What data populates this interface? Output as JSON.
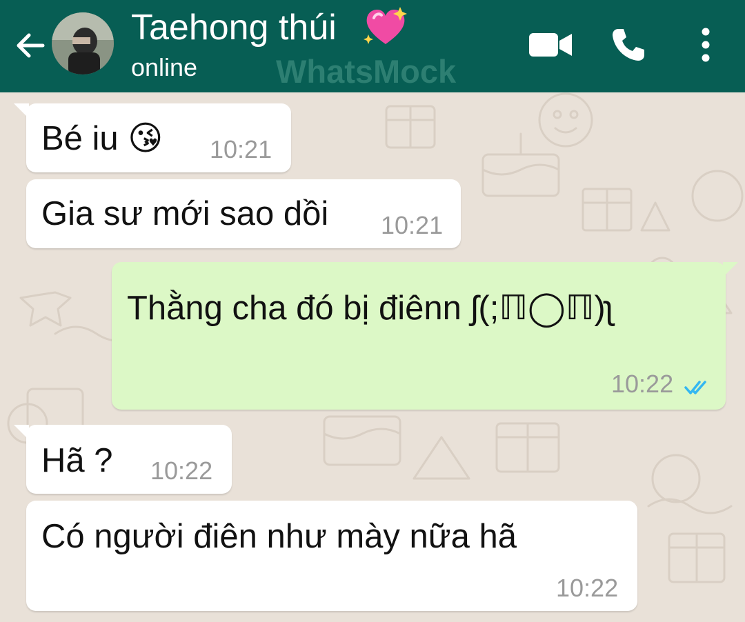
{
  "header": {
    "contact_name": "Taehong thúi",
    "status": "online",
    "watermark": "WhatsMock",
    "background_color": "#075e54",
    "icons": [
      "back-arrow-icon",
      "avatar",
      "sparkling-heart-icon",
      "video-call-icon",
      "phone-call-icon",
      "more-options-icon"
    ]
  },
  "messages": [
    {
      "direction": "incoming",
      "text": "Bé iu 😘",
      "time": "10:21"
    },
    {
      "direction": "incoming",
      "text": "Gia sư mới sao dồi",
      "time": "10:21"
    },
    {
      "direction": "outgoing",
      "text": "Thằng cha đó bị điênn ʃ(;ℿ◯ℿ)ʅ",
      "time": "10:22",
      "read_receipt": "double-check-blue"
    },
    {
      "direction": "incoming",
      "text": "Hã ?",
      "time": "10:22"
    },
    {
      "direction": "incoming",
      "text": "Có người điên như mày nữa hã",
      "time": "10:22"
    }
  ],
  "colors": {
    "incoming_bubble": "#ffffff",
    "outgoing_bubble": "#dcf8c6",
    "chat_background": "#e9e1d8",
    "read_check": "#34b7f1"
  }
}
